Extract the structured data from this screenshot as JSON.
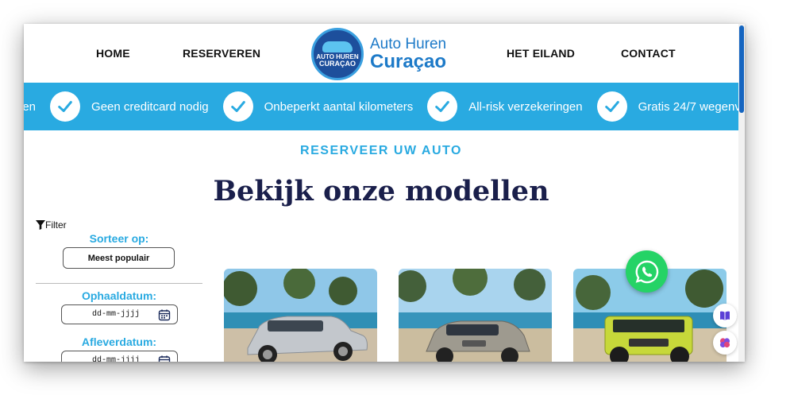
{
  "nav": {
    "home": "HOME",
    "reserveren": "RESERVEREN",
    "het_eiland": "HET EILAND",
    "contact": "CONTACT"
  },
  "logo": {
    "badge_line1": "AUTO HUREN",
    "badge_line2": "CURAÇAO",
    "text_line1": "Auto Huren",
    "text_line2": "Curaçao"
  },
  "banner": {
    "items": [
      "gen",
      "Geen creditcard nodig",
      "Onbeperkt aantal kilometers",
      "All-risk verzekeringen",
      "Gratis 24/7 wegenv"
    ]
  },
  "main": {
    "eyebrow": "RESERVEER UW AUTO",
    "headline": "Bekijk onze modellen"
  },
  "sidebar": {
    "filter_label": "Filter",
    "sort_label": "Sorteer op:",
    "sort_value": "Meest populair",
    "pickup_label": "Ophaaldatum:",
    "pickup_placeholder": "dd-mm-jjjj",
    "return_label": "Afleverdatum:",
    "return_placeholder": "dd-mm-jjjj"
  },
  "cars": [
    {
      "icon": "silver-suv-image",
      "color": "#c3c7cc"
    },
    {
      "icon": "grey-suv-image",
      "color": "#9e9a8f"
    },
    {
      "icon": "green-jeep-image",
      "color": "#c7d83a"
    }
  ],
  "colors": {
    "accent": "#29aae1",
    "headline": "#1a1f4b",
    "whatsapp": "#25d366",
    "brand": "#1d7ac8"
  }
}
